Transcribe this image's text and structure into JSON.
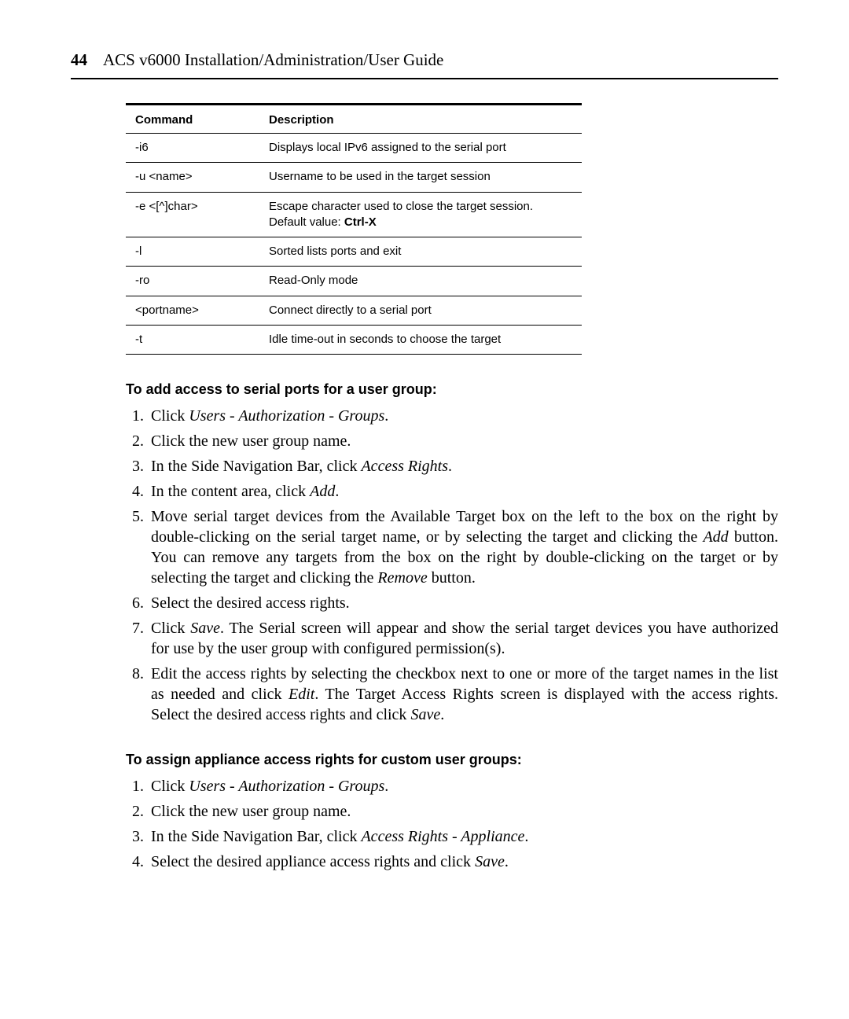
{
  "header": {
    "page_number": "44",
    "title": "ACS v6000 Installation/Administration/User Guide"
  },
  "table": {
    "head": {
      "cmd": "Command",
      "desc": "Description"
    },
    "rows": [
      {
        "cmd": "-i6",
        "desc": "Displays local IPv6 assigned to the serial port"
      },
      {
        "cmd": "-u <name>",
        "desc": "Username to be used in the target session"
      },
      {
        "cmd": "-e <[^]char>",
        "desc_pre": "Escape character used to close the target session. Default value: ",
        "desc_bold": "Ctrl-X"
      },
      {
        "cmd": "-l",
        "desc": "Sorted lists ports and exit"
      },
      {
        "cmd": "-ro",
        "desc": "Read-Only mode"
      },
      {
        "cmd": "<portname>",
        "desc": "Connect directly to a serial port"
      },
      {
        "cmd": "-t",
        "desc": "Idle time-out in seconds to choose the target"
      }
    ]
  },
  "section1": {
    "title": "To add access to serial ports for a user group:",
    "steps": {
      "s1_a": "Click ",
      "s1_b": "Users - Authorization - Groups",
      "s1_c": ".",
      "s2": "Click the new user group name.",
      "s3_a": "In the Side Navigation Bar, click ",
      "s3_b": "Access Rights",
      "s3_c": ".",
      "s4_a": "In the content area, click ",
      "s4_b": "Add",
      "s4_c": ".",
      "s5_a": "Move serial target devices from the Available Target box on the left to the box on the right by double-clicking on the serial target name, or by selecting the target and clicking the ",
      "s5_b": "Add",
      "s5_c": " button. You can remove any targets from the box on the right by double-clicking on the target or by selecting the target and clicking the ",
      "s5_d": "Remove",
      "s5_e": " button.",
      "s6": "Select the desired access rights.",
      "s7_a": "Click ",
      "s7_b": "Save",
      "s7_c": ". The Serial screen will appear and show the serial target devices you have authorized for use by the user group with configured permission(s).",
      "s8_a": "Edit the access rights by selecting the checkbox next to one or more of the target names in the list as needed and click ",
      "s8_b": "Edit",
      "s8_c": ". The Target Access Rights screen is displayed with the access rights. Select the desired access rights and click ",
      "s8_d": "Save",
      "s8_e": "."
    }
  },
  "section2": {
    "title": "To assign appliance access rights for custom user groups:",
    "steps": {
      "s1_a": "Click ",
      "s1_b": "Users - Authorization - Groups",
      "s1_c": ".",
      "s2": "Click the new user group name.",
      "s3_a": "In the Side Navigation Bar, click ",
      "s3_b": "Access Rights - Appliance",
      "s3_c": ".",
      "s4_a": "Select the desired appliance access rights and click ",
      "s4_b": "Save",
      "s4_c": "."
    }
  }
}
